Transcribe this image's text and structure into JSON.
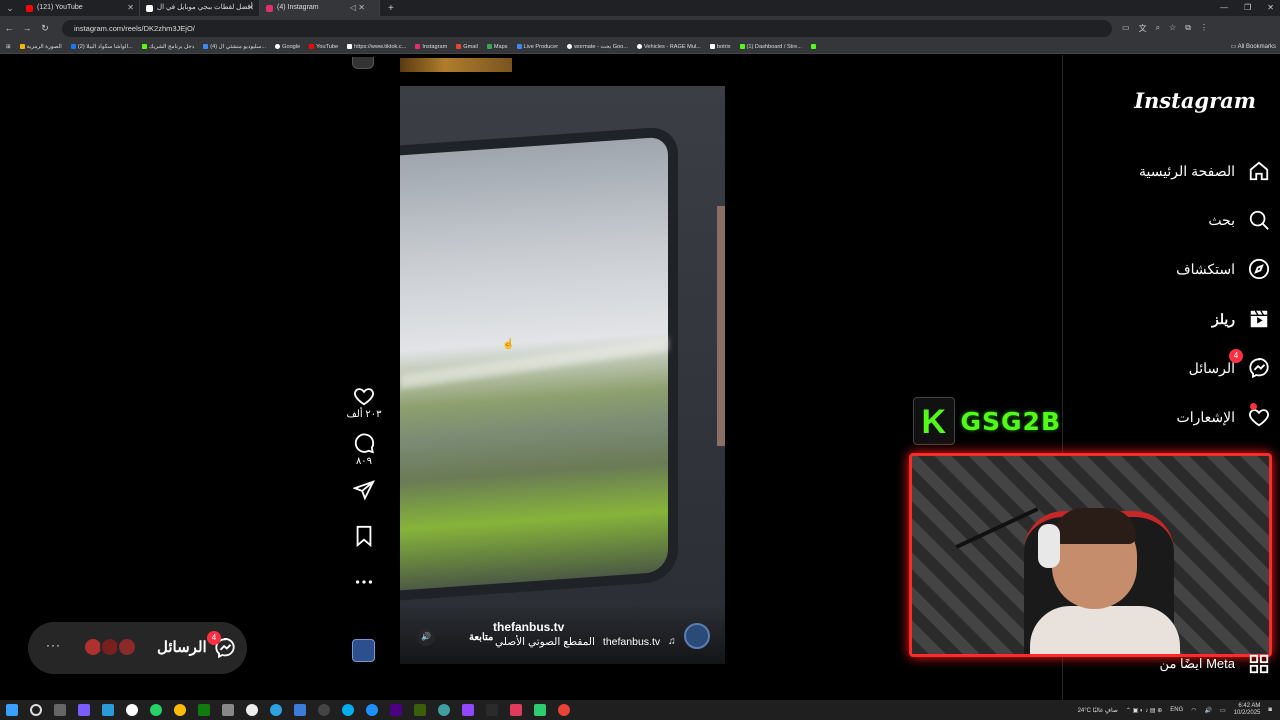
{
  "browser": {
    "tabs": [
      {
        "title": "(121) YouTube",
        "color": "#ff0000",
        "active": false
      },
      {
        "title": "أفضل لقطات ببجي موبايل في ال",
        "color": "#ffffff",
        "active": false
      },
      {
        "title": "(4) Instagram",
        "color": "#e1306c",
        "active": true
      }
    ],
    "url": "instagram.com/reels/DK2zhm3JEjO/",
    "bookmarks": [
      {
        "label": "الصورة الرمزية",
        "color": "#f4b400"
      },
      {
        "label": "(2) الواشا سكواد البيلا...",
        "color": "#1877f2"
      },
      {
        "label": "دخل برنامج الشريك",
        "color": "#53fc18"
      },
      {
        "label": "(4) سليوديو منشئي ال...",
        "color": "#4285f4"
      },
      {
        "label": "Google",
        "color": "#ffffff"
      },
      {
        "label": "YouTube",
        "color": "#ff0000"
      },
      {
        "label": "https://www.tiktok.c...",
        "color": "#ffffff"
      },
      {
        "label": "Instagram",
        "color": "#e1306c"
      },
      {
        "label": "Gmail",
        "color": "#ea4335"
      },
      {
        "label": "Maps",
        "color": "#34a853"
      },
      {
        "label": "Live Producer",
        "color": "#4285f4"
      },
      {
        "label": "wormate - بحث Goo...",
        "color": "#ffffff"
      },
      {
        "label": "Vehicles - RAGE Mul...",
        "color": "#ffffff"
      },
      {
        "label": "botrix",
        "color": "#ffffff"
      },
      {
        "label": "(1) Dashboard / Stre...",
        "color": "#53fc18"
      },
      {
        "label": "",
        "color": "#53fc18"
      }
    ],
    "all_bookmarks": "All Bookmarks"
  },
  "sidebar": {
    "logo": "Instagram",
    "items": [
      {
        "label": "الصفحة الرئيسية",
        "icon": "home-icon"
      },
      {
        "label": "بحث",
        "icon": "search-icon"
      },
      {
        "label": "استكشاف",
        "icon": "compass-icon"
      },
      {
        "label": "ريلز",
        "icon": "reels-icon"
      },
      {
        "label": "الرسائل",
        "icon": "messenger-icon",
        "badge": "4"
      },
      {
        "label": "الإشعارات",
        "icon": "heart-icon"
      }
    ],
    "meta": "ايضًا من Meta"
  },
  "reel": {
    "username": "thefanbus.tv",
    "follow": "متابعة",
    "audio_owner": "thefanbus.tv",
    "audio_title": "المقطع الصوتي الأصلي",
    "likes": "٢٠٣ ألف",
    "comments": "٨٠٩"
  },
  "messages_pill": {
    "label": "الرسائل",
    "badge": "4",
    "more": "···"
  },
  "overlay": {
    "brand_letter": "K",
    "brand_name": "GSG2B",
    "brand_color": "#53fc18"
  },
  "taskbar": {
    "weather": "24°C صافٍ غالبًا",
    "lang": "ENG",
    "time": "6:42 AM",
    "date": "10/2/2025"
  }
}
